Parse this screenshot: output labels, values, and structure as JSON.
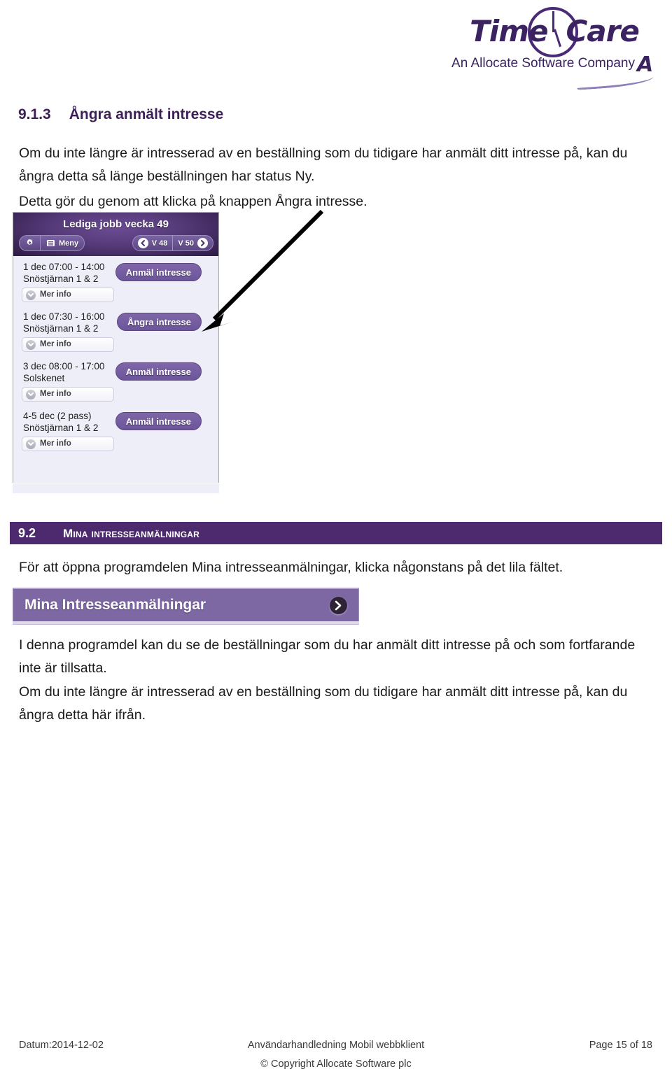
{
  "logo": {
    "word_part1": "Time",
    "word_part2": "Care",
    "tagline": "An Allocate Software Company",
    "mark_letter": "A"
  },
  "section_913": {
    "number": "9.1.3",
    "title": "Ångra anmält intresse",
    "paragraph1": "Om du inte längre är intresserad av en beställning som du tidigare har anmält ditt intresse på, kan du ångra detta så länge beställningen har status Ny.",
    "paragraph2": "Detta gör du genom att klicka på knappen Ångra intresse."
  },
  "app_screenshot": {
    "title": "Lediga jobb vecka 49",
    "toolbar": {
      "settings_icon": "gear-icon",
      "menu_icon": "hamburger-icon",
      "menu_label": "Meny",
      "prev_icon": "chevron-left-icon",
      "prev_week_label": "V 48",
      "next_week_label": "V 50",
      "next_icon": "chevron-right-icon"
    },
    "more_info_label": "Mer info",
    "jobs": [
      {
        "when": "1 dec 07:00 - 14:00",
        "where": "Snöstjärnan 1 & 2",
        "action": "Anmäl intresse"
      },
      {
        "when": "1 dec 07:30 - 16:00",
        "where": "Snöstjärnan 1 & 2",
        "action": "Ångra intresse"
      },
      {
        "when": "3 dec 08:00 - 17:00",
        "where": "Solskenet",
        "action": "Anmäl intresse"
      },
      {
        "when": "4-5 dec (2 pass)",
        "where": "Snöstjärnan 1 & 2",
        "action": "Anmäl intresse"
      }
    ]
  },
  "section_92": {
    "number": "9.2",
    "title": "Mina intresseanmälningar",
    "intro": "För att öppna programdelen Mina intresseanmälningar, klicka någonstans på det lila fältet.",
    "bar_label": "Mina Intresseanmälningar",
    "bar_icon": "chevron-right-icon",
    "paragraph1": "I denna programdel kan du se de beställningar som du har anmält ditt intresse på och som fortfarande inte är tillsatta.",
    "paragraph2": "Om du inte längre är intresserad av en beställning som du tidigare har anmält ditt intresse på, kan du ångra detta här ifrån."
  },
  "footer": {
    "date": "Datum:2014-12-02",
    "document_title": "Användarhandledning Mobil webbklient",
    "page": "Page 15 of 18",
    "copyright": "© Copyright Allocate Software plc"
  },
  "colors": {
    "heading_purple": "#3d1f57",
    "band_purple": "#4c2a6d",
    "bar_purple": "#7d68a4",
    "app_header_purple": "#553a79",
    "app_body": "#eeeef8"
  }
}
